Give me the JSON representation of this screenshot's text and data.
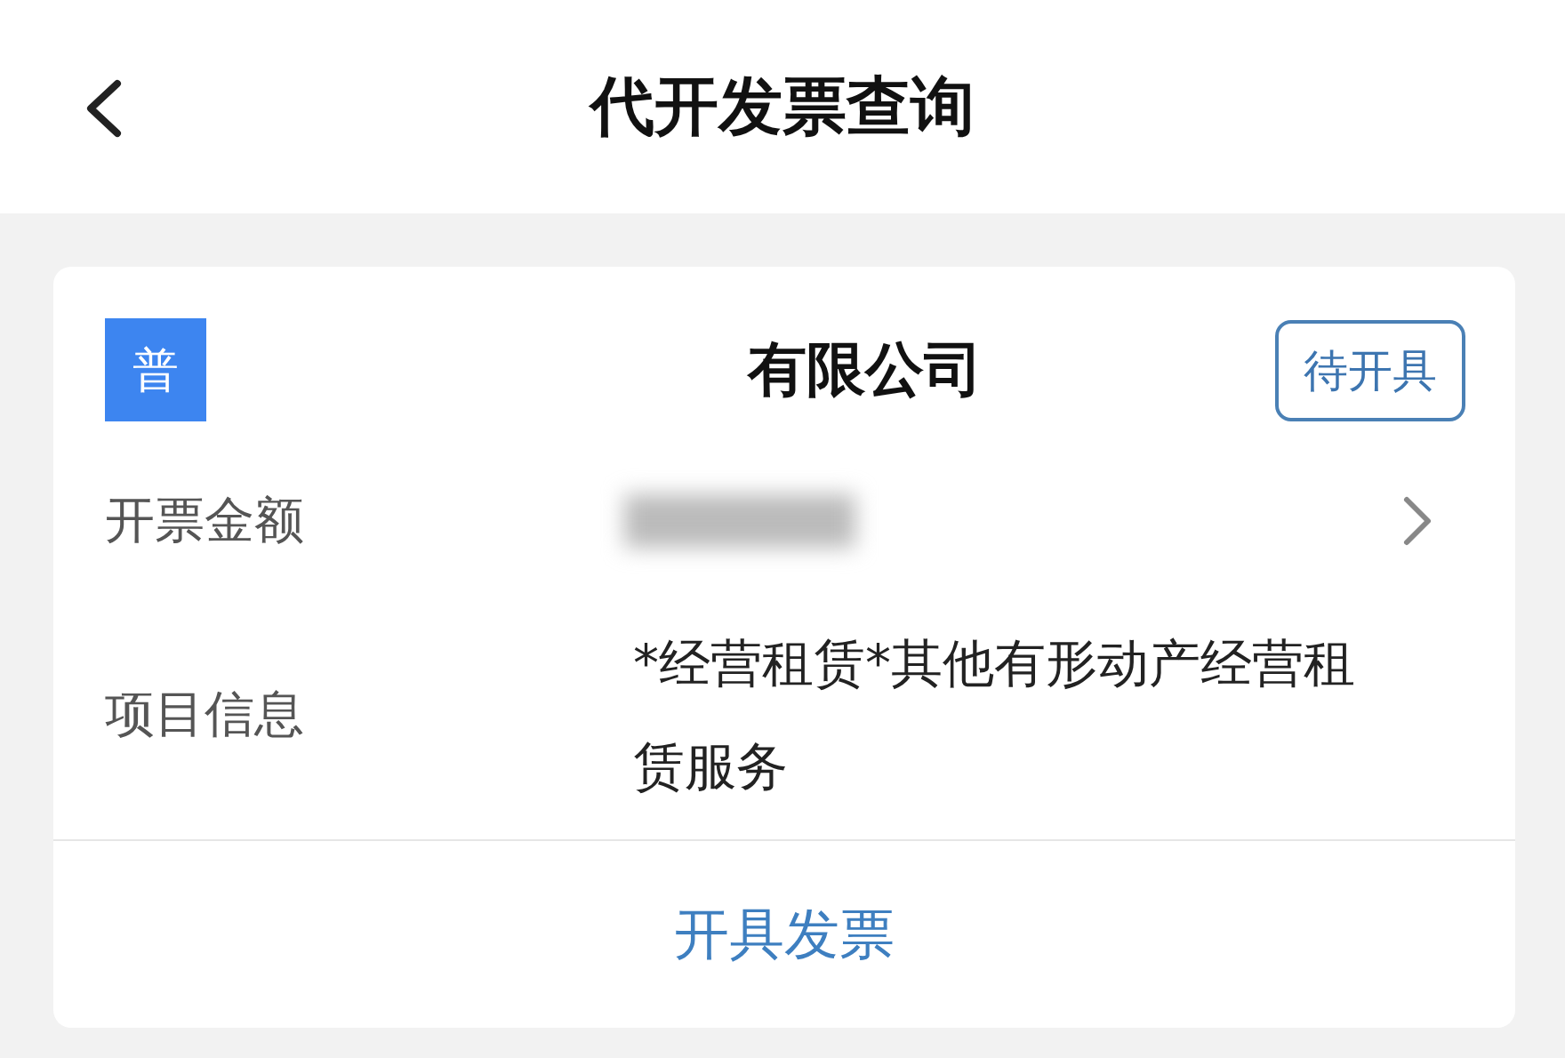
{
  "header": {
    "title": "代开发票查询"
  },
  "invoice": {
    "type_badge": "普",
    "company": "有限公司",
    "status": "待开具",
    "rows": [
      {
        "kind": "amount",
        "label": "开票金额"
      },
      {
        "kind": "text",
        "label": "项目信息",
        "value": "*经营租赁*其他有形动产经营租赁服务"
      }
    ],
    "action": "开具发票"
  }
}
